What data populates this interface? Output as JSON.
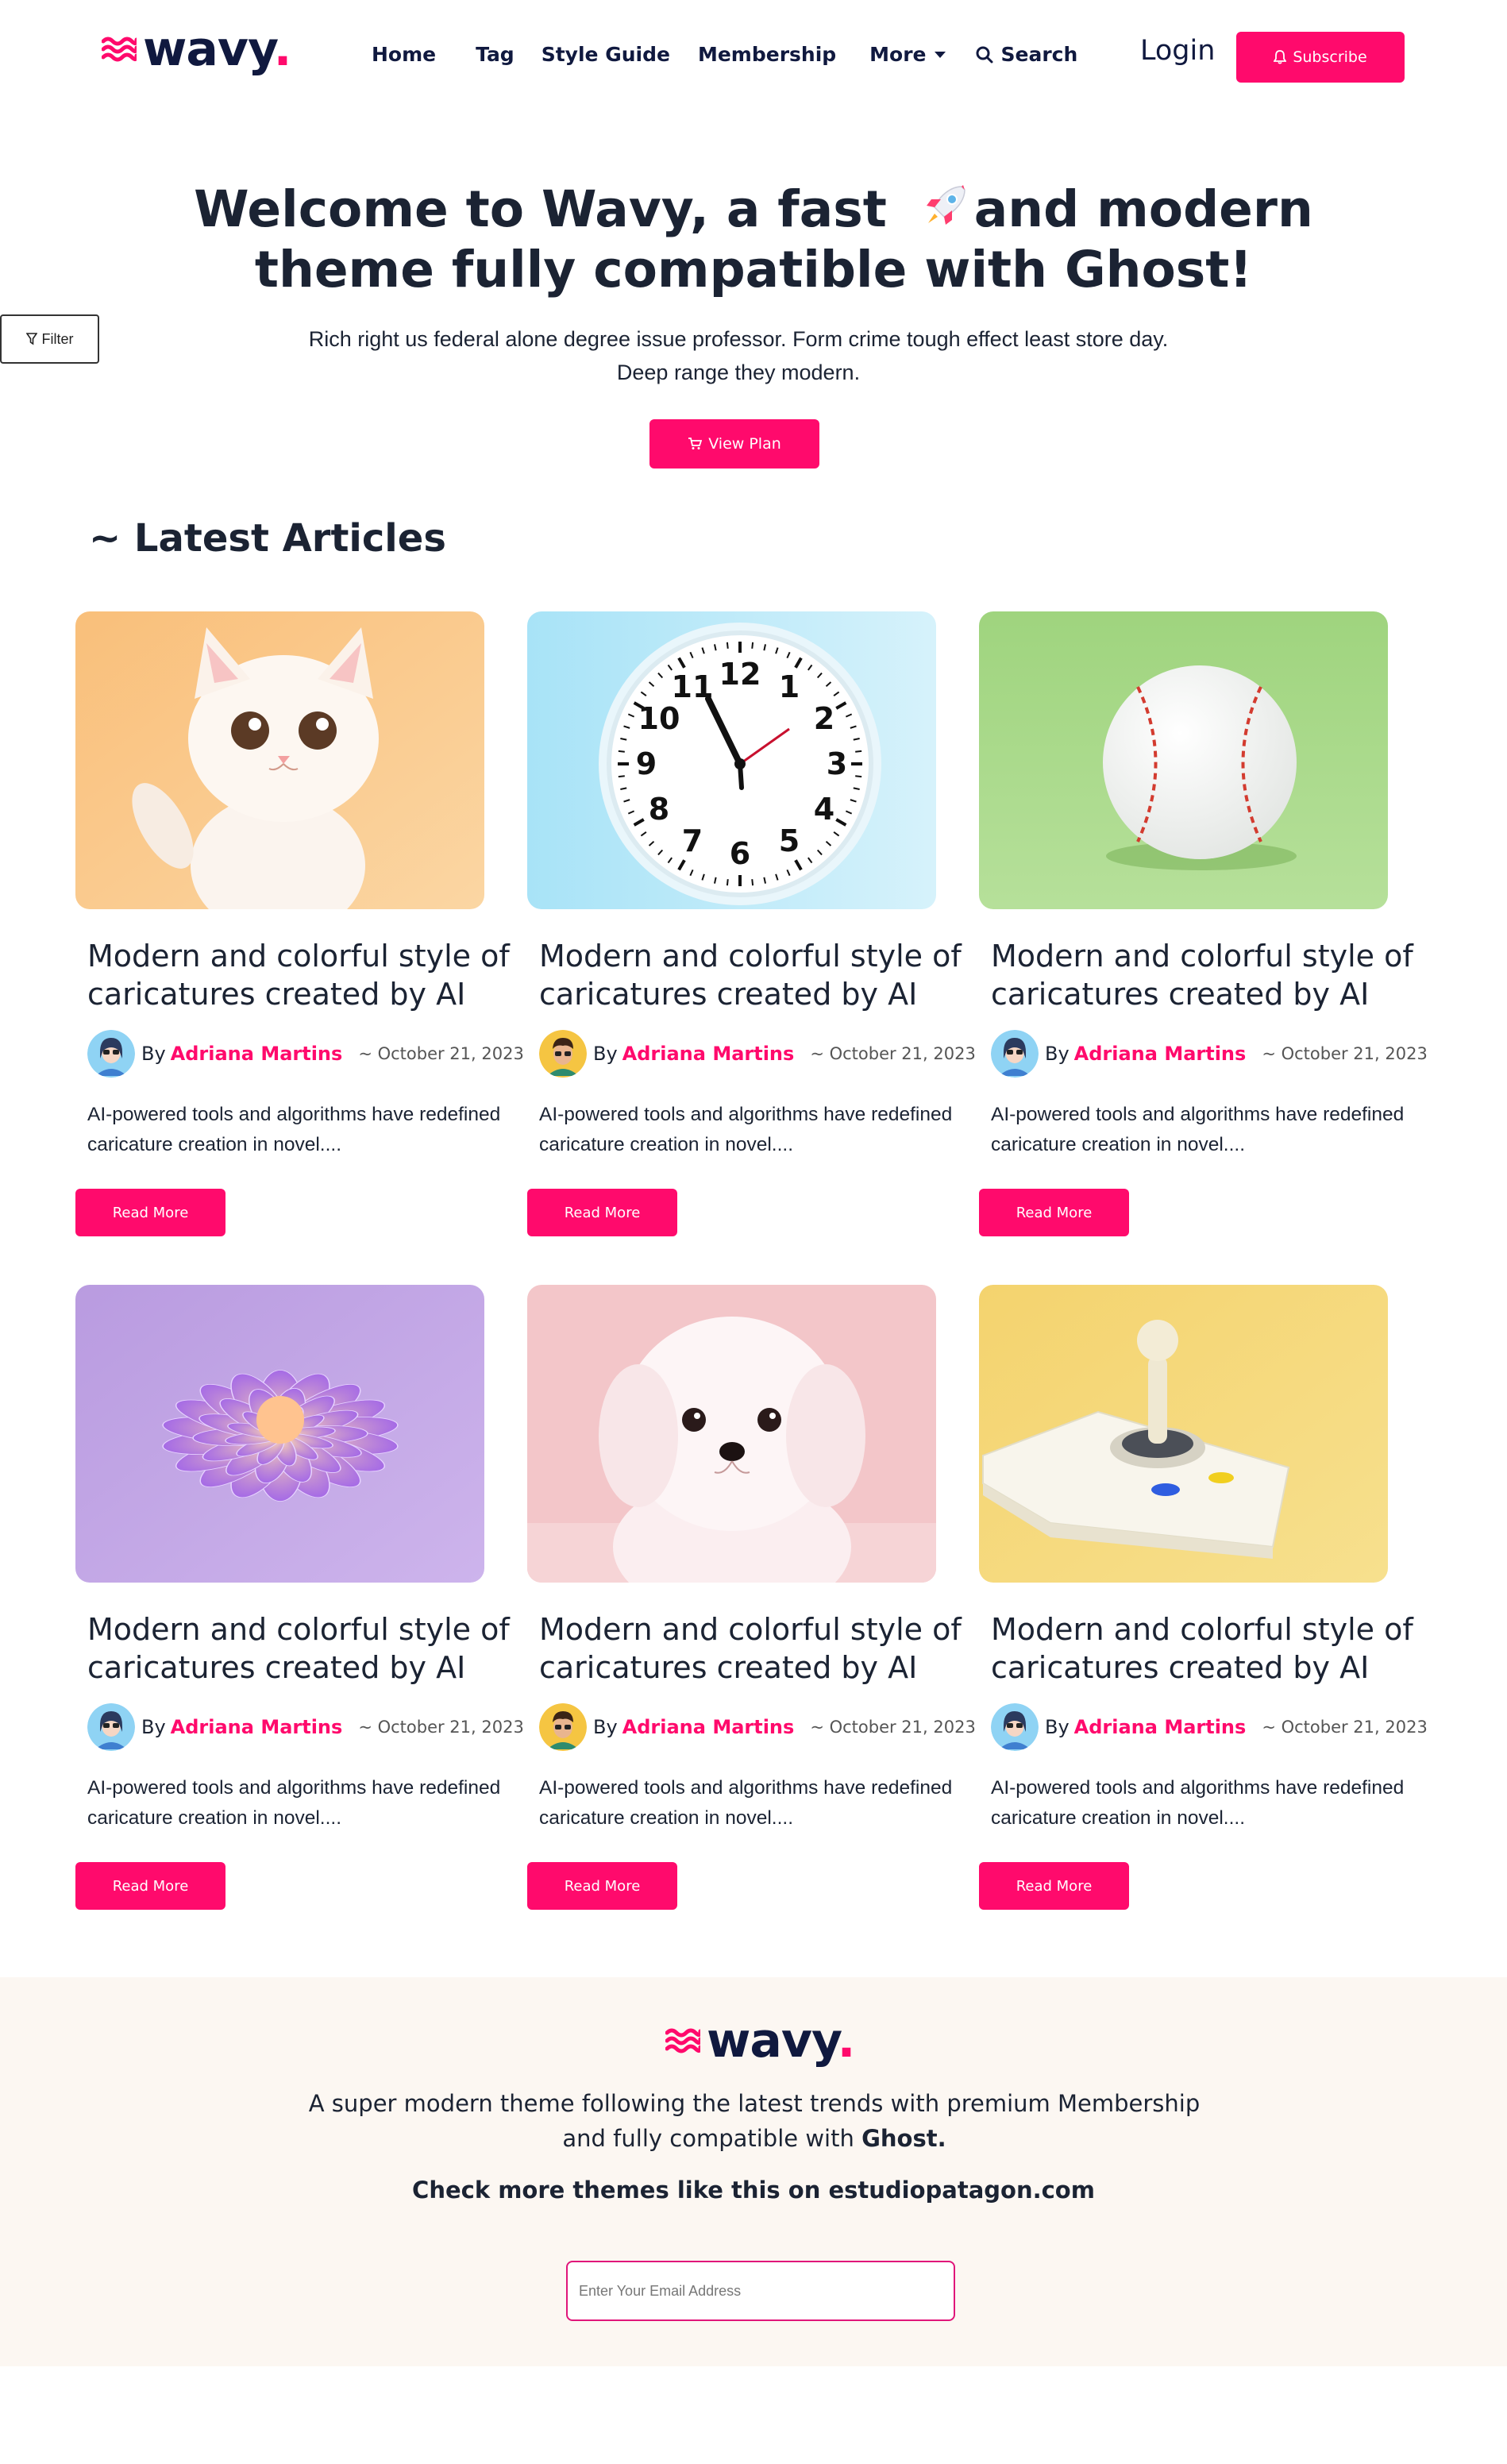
{
  "header": {
    "logo_text": "wavy",
    "logo_dot": ".",
    "nav": {
      "home": "Home",
      "tag": "Tag",
      "style_guide": "Style Guide",
      "membership": "Membership",
      "more": "More",
      "search": "Search"
    },
    "login": "Login",
    "subscribe": "Subscribe"
  },
  "filter_label": "Filter",
  "hero": {
    "title_part1": "Welcome to Wavy, a fast",
    "title_part2": "and modern",
    "title_line2": "theme fully compatible with Ghost!",
    "description": "Rich right us federal alone degree issue professor. Form crime tough effect least store day. Deep range they modern.",
    "button": "View Plan"
  },
  "section_title": "~ Latest Articles",
  "articles": [
    {
      "title": "Modern and colorful style of caricatures created by AI",
      "by": "By",
      "author": "Adriana Martins",
      "date": "~ October 21, 2023",
      "excerpt": "AI-powered tools and algorithms have redefined caricature creation in novel....",
      "button": "Read More",
      "image": "kitten"
    },
    {
      "title": "Modern and colorful style of caricatures created by AI",
      "by": "By",
      "author": "Adriana Martins",
      "date": "~ October 21, 2023",
      "excerpt": "AI-powered tools and algorithms have redefined caricature creation in novel....",
      "button": "Read More",
      "image": "clock"
    },
    {
      "title": "Modern and colorful style of caricatures created by AI",
      "by": "By",
      "author": "Adriana Martins",
      "date": "~ October 21, 2023",
      "excerpt": "AI-powered tools and algorithms have redefined caricature creation in novel....",
      "button": "Read More",
      "image": "baseball"
    },
    {
      "title": "Modern and colorful style of caricatures created by AI",
      "by": "By",
      "author": "Adriana Martins",
      "date": "~ October 21, 2023",
      "excerpt": "AI-powered tools and algorithms have redefined caricature creation in novel....",
      "button": "Read More",
      "image": "flower"
    },
    {
      "title": "Modern and colorful style of caricatures created by AI",
      "by": "By",
      "author": "Adriana Martins",
      "date": "~ October 21, 2023",
      "excerpt": "AI-powered tools and algorithms have redefined caricature creation in novel....",
      "button": "Read More",
      "image": "puppy"
    },
    {
      "title": "Modern and colorful style of caricatures created by AI",
      "by": "By",
      "author": "Adriana Martins",
      "date": "~ October 21, 2023",
      "excerpt": "AI-powered tools and algorithms have redefined caricature creation in novel....",
      "button": "Read More",
      "image": "joystick"
    }
  ],
  "footer": {
    "logo_text": "wavy",
    "logo_dot": ".",
    "desc_part1": "A super modern theme following the latest trends with premium Membership and fully compatible with",
    "desc_bold": "Ghost.",
    "check_text": "Check more themes like this on estudiopatagon.com",
    "email_placeholder": "Enter Your Email Address"
  },
  "colors": {
    "accent": "#ff0a6c",
    "navy": "#10193f",
    "footer_bg": "#fcf7f2"
  }
}
